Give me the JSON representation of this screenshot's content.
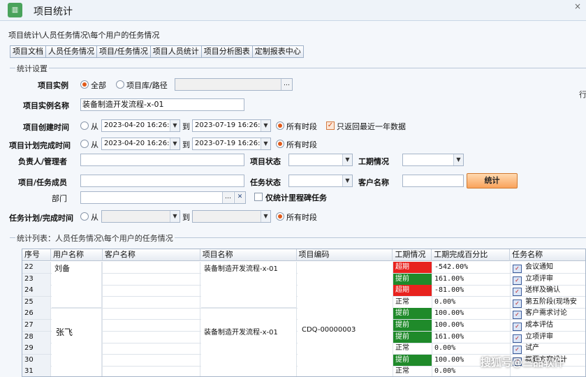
{
  "window": {
    "title": "项目统计",
    "close": "×"
  },
  "breadcrumb": "项目统计\\人员任务情况\\每个用户的任务情况",
  "tabs": [
    "项目文档",
    "人员任务情况",
    "项目/任务情况",
    "项目人员统计",
    "项目分析图表",
    "定制报表中心"
  ],
  "settings": {
    "legend": "统计设置",
    "project_instance_label": "项目实例",
    "radio_all": "全部",
    "radio_library": "项目库/路径",
    "library_path": "",
    "instance_name_label": "项目实例名称",
    "instance_name_value": "装备制造开发流程-x-01",
    "create_time_label": "项目创建时间",
    "plan_finish_label": "项目计划完成时间",
    "from": "从",
    "to": "到",
    "all_periods": "所有时段",
    "create_from": "2023-04-20 16:26:",
    "create_to": "2023-07-19 16:26:",
    "plan_from": "2023-04-20 16:26:",
    "plan_to": "2023-07-19 16:26:",
    "recent_year": "只返回最近一年数据",
    "owner_label": "负责人/管理者",
    "project_status_label": "项目状态",
    "period_label": "工期情况",
    "member_label": "项目/任务成员",
    "task_status_label": "任务状态",
    "customer_label": "客户名称",
    "stat_button": "统计",
    "dept_label": "部门",
    "milestone_only": "仅统计里程碑任务",
    "task_plan_label": "任务计划/完成时间",
    "side_mark": "行"
  },
  "list": {
    "legend": "统计列表：人员任务情况\\每个用户的任务情况",
    "columns": [
      "序号",
      "用户名称",
      "客户名称",
      "项目名称",
      "项目编码",
      "工期情况",
      "工期完成百分比",
      "任务名称"
    ],
    "users": [
      "刘备",
      "张飞"
    ],
    "project_name": "装备制造开发流程-x-01",
    "project_code": "CDQ-00000003",
    "rows": [
      {
        "seq": "22",
        "status": "超期",
        "pct": "-542.00%",
        "task": "会议通知"
      },
      {
        "seq": "23",
        "status": "提前",
        "pct": "161.00%",
        "task": "立项评审"
      },
      {
        "seq": "24",
        "status": "超期",
        "pct": "-81.00%",
        "task": "送样及确认"
      },
      {
        "seq": "25",
        "status": "正常",
        "pct": "0.00%",
        "task": "第五阶段(现场安"
      },
      {
        "seq": "26",
        "status": "提前",
        "pct": "100.00%",
        "task": "客户需求讨论"
      },
      {
        "seq": "27",
        "status": "提前",
        "pct": "100.00%",
        "task": "成本评估"
      },
      {
        "seq": "28",
        "status": "提前",
        "pct": "161.00%",
        "task": "立项评审"
      },
      {
        "seq": "29",
        "status": "正常",
        "pct": "0.00%",
        "task": "试产"
      },
      {
        "seq": "30",
        "status": "提前",
        "pct": "100.00%",
        "task": "概要方案设计"
      },
      {
        "seq": "31",
        "status": "正常",
        "pct": "0.00%",
        "task": ""
      }
    ]
  },
  "watermark": "搜狐号@三品软件",
  "colors": {
    "overdue": "#e8221e",
    "ahead": "#1f8a2a",
    "accent": "#f9a35c"
  }
}
